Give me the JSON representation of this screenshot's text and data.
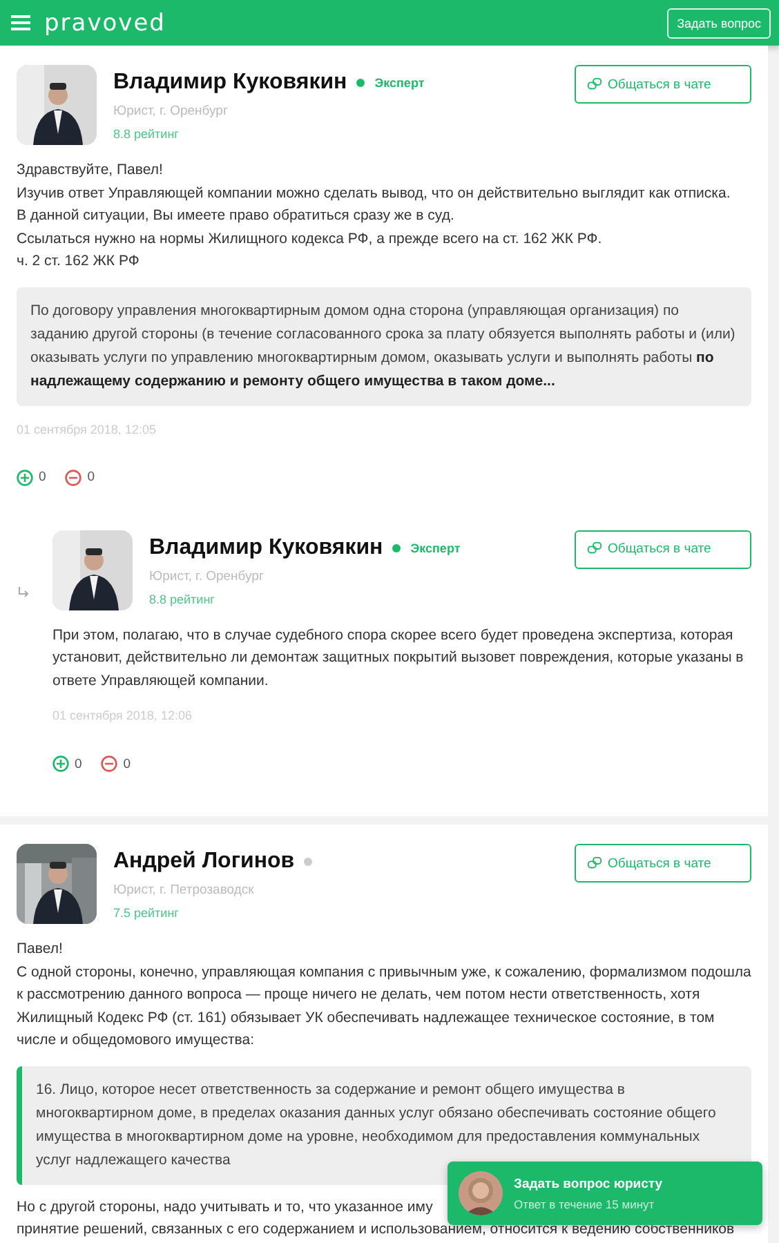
{
  "header": {
    "logo": "pravoved",
    "ask_button": "Задать вопрос"
  },
  "answers": [
    {
      "kind": "answer",
      "name": "Владимир Куковякин",
      "online": true,
      "badge": "Эксперт",
      "role": "Юрист, г. Оренбург",
      "rating": "8.8 рейтинг",
      "chat_button": "Общаться в чате",
      "paragraphs": [
        "Здравствуйте, Павел!",
        "Изучив ответ Управляющей компании можно сделать вывод, что он действительно выглядит как отписка.",
        "В данной ситуации, Вы имеете право обратиться сразу же в суд.",
        "Ссылаться нужно на нормы Жилищного кодекса РФ, а прежде всего на ст. 162 ЖК РФ.",
        "ч. 2 ст. 162 ЖК РФ"
      ],
      "quote": {
        "kind": "plain",
        "text": "По договору управления многоквартирным домом одна сторона (управляющая организация) по заданию другой стороны (в течение согласованного срока за плату обязуется выполнять работы и (или) оказывать услуги по управлению многоквартирным домом, оказывать услуги и выполнять работы **по надлежащему содержанию и ремонту общего имущества в таком доме...**"
      },
      "date": "01 сентября 2018, 12:05",
      "votes_up": "0",
      "votes_down": "0"
    },
    {
      "kind": "reply",
      "name": "Владимир Куковякин",
      "online": true,
      "badge": "Эксперт",
      "role": "Юрист, г. Оренбург",
      "rating": "8.8 рейтинг",
      "chat_button": "Общаться в чате",
      "paragraphs": [
        "При этом, полагаю, что в случае судебного спора скорее всего будет проведена экспертиза, которая установит, действительно ли демонтаж защитных покрытий вызовет повреждения, которые указаны в ответе Управляющей компании."
      ],
      "date": "01 сентября 2018, 12:06",
      "votes_up": "0",
      "votes_down": "0"
    },
    {
      "kind": "answer",
      "name": "Андрей Логинов",
      "online": false,
      "role": "Юрист, г. Петрозаводск",
      "rating": "7.5 рейтинг",
      "chat_button": "Общаться в чате",
      "paragraphs": [
        "Павел!",
        "С одной стороны, конечно, управляющая компания с привычным уже, к сожалению, формализмом подошла к рассмотрению данного вопроса — проще ничего не делать, чем потом нести ответственность, хотя Жилищный Кодекс РФ (ст. 161) обязывает УК обеспечивать надлежащее техническое состояние, в том числе и общедомового имущества:"
      ],
      "quote": {
        "kind": "bar",
        "text": "16. Лицо, которое несет ответственность за содержание и ремонт общего имущества в многоквартирном доме, в пределах оказания данных услуг обязано обеспечивать состояние общего имущества в многоквартирном доме на уровне, необходимом для предоставления коммунальных услуг надлежащего качества"
      },
      "tail_lines": [
        "Но с другой стороны, надо учитывать и то, что указанное иму",
        "принятие решений, связанных с его содержанием и использованием, относится к ведению собственников"
      ]
    }
  ],
  "floating_widget": {
    "title": "Задать вопрос юристу",
    "subtitle": "Ответ в течение 15 минут"
  }
}
